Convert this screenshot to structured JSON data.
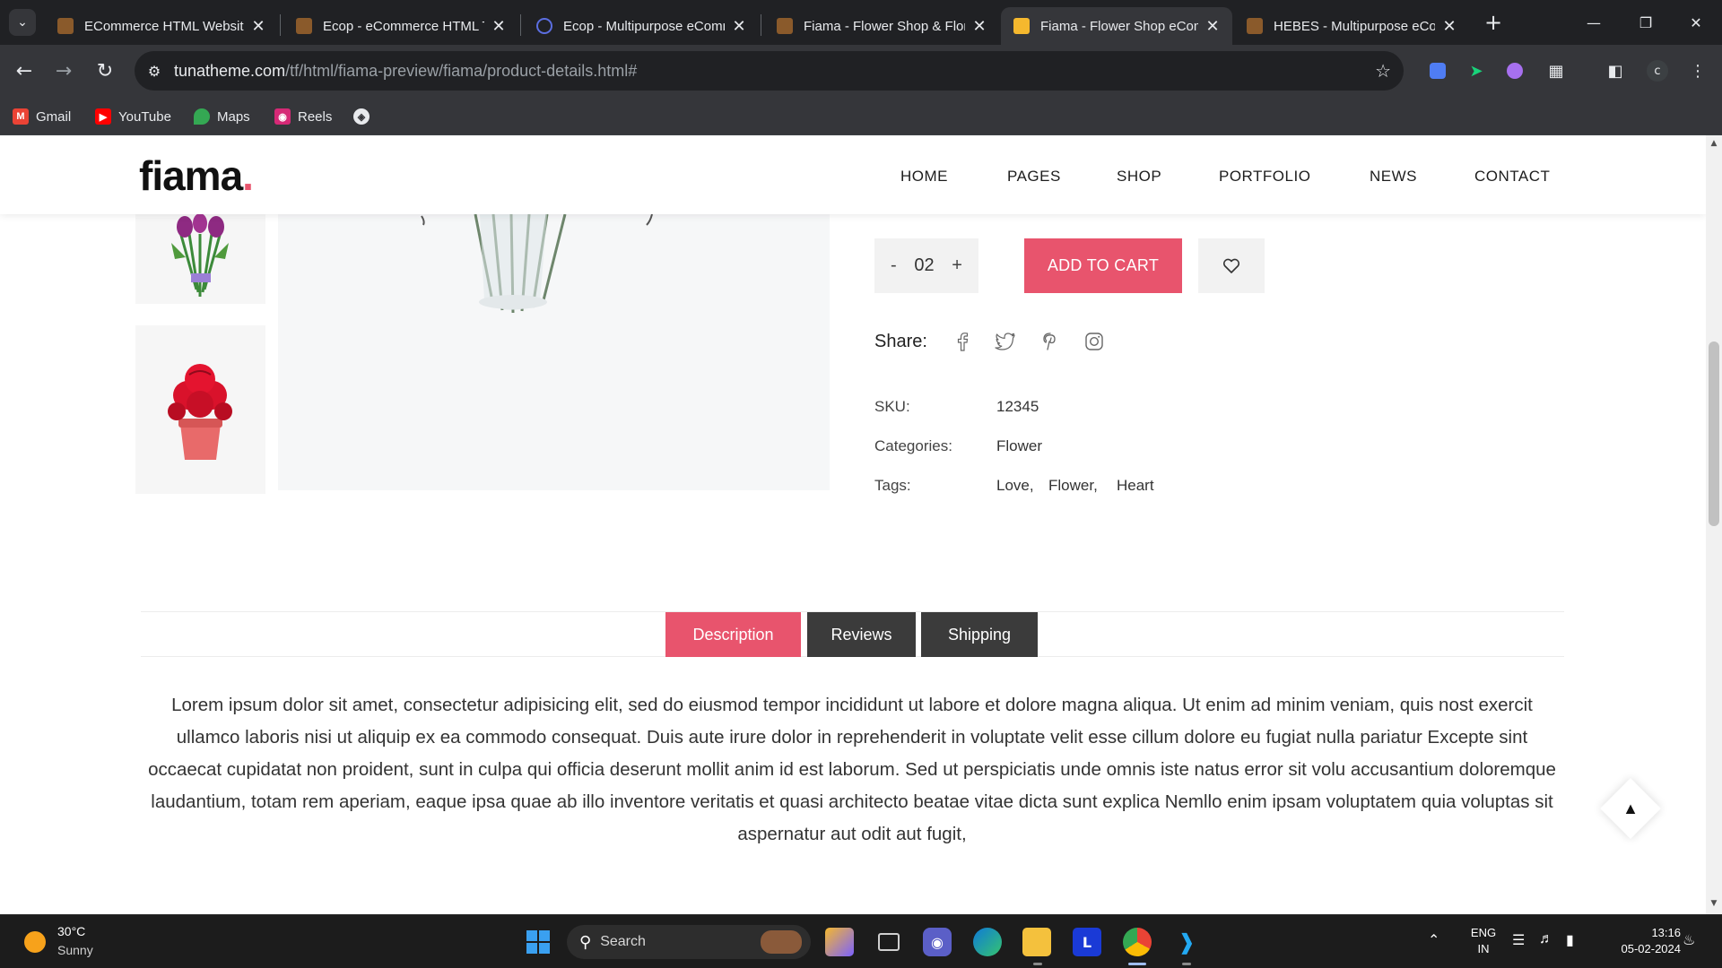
{
  "browser": {
    "tabs": [
      {
        "title": "ECommerce HTML Website",
        "favicon_color": "#8a5a2b"
      },
      {
        "title": "Ecop - eCommerce HTML Template",
        "favicon_color": "#8a5a2b"
      },
      {
        "title": "Ecop - Multipurpose eCommerce",
        "favicon_color": "#5b6ee1"
      },
      {
        "title": "Fiama - Flower Shop & Florist",
        "favicon_color": "#8a5a2b"
      },
      {
        "title": "Fiama - Flower Shop eCommerce",
        "favicon_color": "#f5b82e",
        "active": true
      },
      {
        "title": "HEBES - Multipurpose eCommerce",
        "favicon_color": "#8a5a2b"
      }
    ],
    "url_host": "tunatheme.com",
    "url_path": "/tf/html/fiama-preview/fiama/product-details.html#",
    "profile_initial": "c",
    "bookmarks": [
      {
        "label": "Gmail",
        "icon": "gmail-icon",
        "color": "#ea4335"
      },
      {
        "label": "YouTube",
        "icon": "youtube-icon",
        "color": "#ff0000"
      },
      {
        "label": "Maps",
        "icon": "maps-icon",
        "color": "#34a853"
      },
      {
        "label": "Reels",
        "icon": "instagram-icon",
        "color": "#d62976"
      }
    ]
  },
  "site": {
    "logo_text": "fiama",
    "logo_dot": ".",
    "accent_color": "#e8546d",
    "nav": [
      "HOME",
      "PAGES",
      "SHOP",
      "PORTFOLIO",
      "NEWS",
      "CONTACT"
    ]
  },
  "product": {
    "quantity": "02",
    "qty_minus": "-",
    "qty_plus": "+",
    "add_to_cart": "ADD TO CART",
    "share_label": "Share:",
    "share_icons": [
      "facebook-icon",
      "twitter-icon",
      "pinterest-icon",
      "instagram-icon"
    ],
    "sku_label": "SKU:",
    "sku_value": "12345",
    "categories_label": "Categories:",
    "categories_value": "Flower",
    "tags_label": "Tags:",
    "tags": [
      "Love,",
      "Flower,",
      "Heart"
    ]
  },
  "details_tabs": [
    {
      "label": "Description",
      "active": true
    },
    {
      "label": "Reviews",
      "active": false
    },
    {
      "label": "Shipping",
      "active": false
    }
  ],
  "description": "Lorem ipsum dolor sit amet, consectetur adipisicing elit, sed do eiusmod tempor incididunt ut labore et dolore magna aliqua. Ut enim ad minim veniam, quis nost exercit ullamco laboris nisi ut aliquip ex ea commodo consequat. Duis aute irure dolor in reprehenderit in voluptate velit esse cillum dolore eu fugiat nulla pariatur Excepte sint occaecat cupidatat non proident, sunt in culpa qui officia deserunt mollit anim id est laborum. Sed ut perspiciatis unde omnis iste natus error sit volu accusantium doloremque laudantium, totam rem aperiam, eaque ipsa quae ab illo inventore veritatis et quasi architecto beatae vitae dicta sunt explica Nemllo enim ipsam voluptatem quia voluptas sit aspernatur aut odit aut fugit,",
  "taskbar": {
    "temperature": "30°C",
    "weather": "Sunny",
    "search_label": "Search",
    "lang_line1": "ENG",
    "lang_line2": "IN",
    "time": "13:16",
    "date": "05-02-2024"
  }
}
